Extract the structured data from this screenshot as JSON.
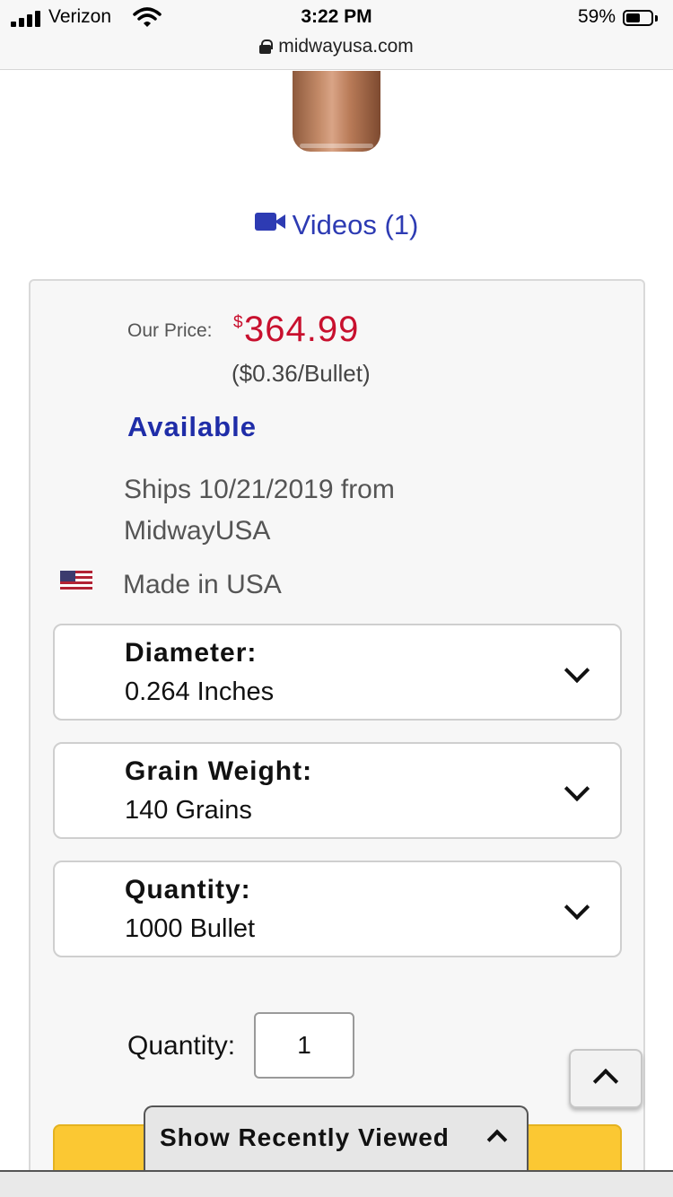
{
  "status_bar": {
    "carrier": "Verizon",
    "time": "3:22 PM",
    "battery_percent": "59%",
    "battery_level": 0.59,
    "url": "midwayusa.com"
  },
  "media": {
    "videos_label": "Videos (1)"
  },
  "pricing": {
    "label": "Our Price:",
    "currency": "$",
    "price": "364.99",
    "unit_price": "($0.36/Bullet)",
    "availability": "Available",
    "shipping": "Ships 10/21/2019 from MidwayUSA",
    "origin": "Made in USA"
  },
  "options": [
    {
      "label": "Diameter:",
      "value": "0.264 Inches"
    },
    {
      "label": "Grain Weight:",
      "value": "140 Grains"
    },
    {
      "label": "Quantity:",
      "value": "1000 Bullet"
    }
  ],
  "order": {
    "quantity_label": "Quantity:",
    "quantity_value": "1"
  },
  "recently_viewed": {
    "label": "Show Recently Viewed"
  },
  "colors": {
    "price": "#c8102e",
    "link": "#2d3bb3",
    "availability": "#1f2da8",
    "cart_button": "#fbc833"
  },
  "icons": [
    "lock-icon",
    "video-icon",
    "us-flag-icon",
    "chevron-down-icon",
    "chevron-up-icon"
  ]
}
